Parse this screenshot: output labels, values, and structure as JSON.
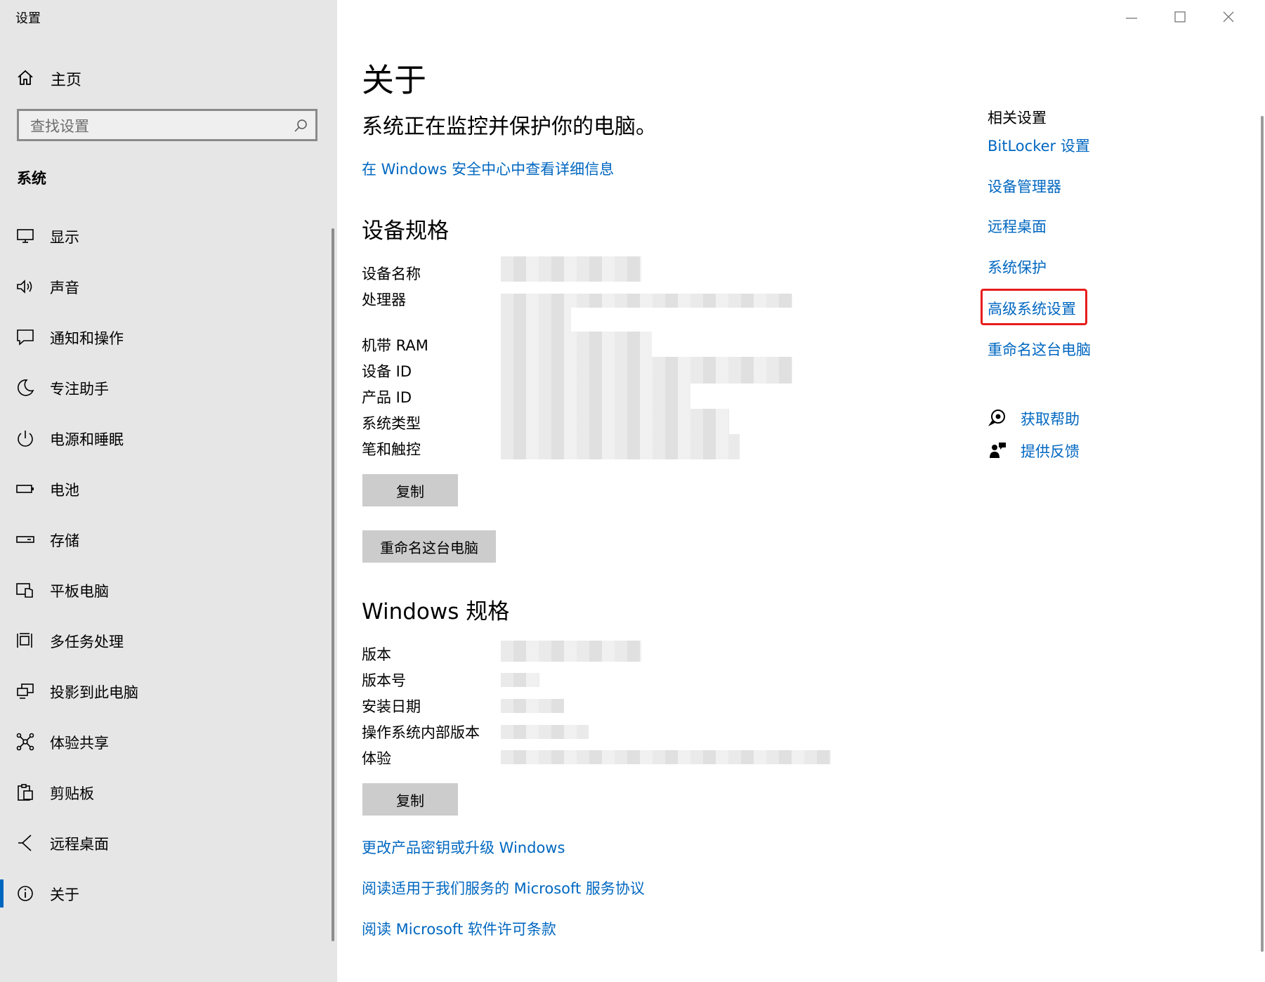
{
  "app": {
    "title": "设置"
  },
  "sidebar": {
    "home_label": "主页",
    "search_placeholder": "查找设置",
    "section_title": "系统",
    "items": [
      {
        "label": "显示",
        "icon": "monitor-icon"
      },
      {
        "label": "声音",
        "icon": "speaker-icon"
      },
      {
        "label": "通知和操作",
        "icon": "notification-icon"
      },
      {
        "label": "专注助手",
        "icon": "moon-icon"
      },
      {
        "label": "电源和睡眠",
        "icon": "power-icon"
      },
      {
        "label": "电池",
        "icon": "battery-icon"
      },
      {
        "label": "存储",
        "icon": "storage-icon"
      },
      {
        "label": "平板电脑",
        "icon": "tablet-icon"
      },
      {
        "label": "多任务处理",
        "icon": "multitask-icon"
      },
      {
        "label": "投影到此电脑",
        "icon": "project-icon"
      },
      {
        "label": "体验共享",
        "icon": "share-icon"
      },
      {
        "label": "剪贴板",
        "icon": "clipboard-icon"
      },
      {
        "label": "远程桌面",
        "icon": "remote-desktop-icon"
      },
      {
        "label": "关于",
        "icon": "info-icon",
        "active": true
      }
    ]
  },
  "main": {
    "title": "关于",
    "status_text": "系统正在监控并保护你的电脑。",
    "security_link": "在 Windows 安全中心中查看详细信息",
    "device_specs": {
      "heading": "设备规格",
      "labels": [
        "设备名称",
        "处理器",
        "机带 RAM",
        "设备 ID",
        "产品 ID",
        "系统类型",
        "笔和触控"
      ],
      "copy_button": "复制",
      "rename_button": "重命名这台电脑"
    },
    "windows_specs": {
      "heading": "Windows 规格",
      "labels": [
        "版本",
        "版本号",
        "安装日期",
        "操作系统内部版本",
        "体验"
      ],
      "copy_button": "复制"
    },
    "bottom_links": [
      "更改产品密钥或升级 Windows",
      "阅读适用于我们服务的 Microsoft 服务协议",
      "阅读 Microsoft 软件许可条款"
    ]
  },
  "related": {
    "title": "相关设置",
    "links": [
      "BitLocker 设置",
      "设备管理器",
      "远程桌面",
      "系统保护",
      "高级系统设置",
      "重命名这台电脑"
    ],
    "help": {
      "label": "获取帮助",
      "icon": "chat-help-icon"
    },
    "feedback": {
      "label": "提供反馈",
      "icon": "feedback-icon"
    }
  },
  "colors": {
    "accent": "#0067c0",
    "sidebar_bg": "#e6e6e6",
    "highlight": "#e81c1c",
    "button_bg": "#cccccc"
  }
}
